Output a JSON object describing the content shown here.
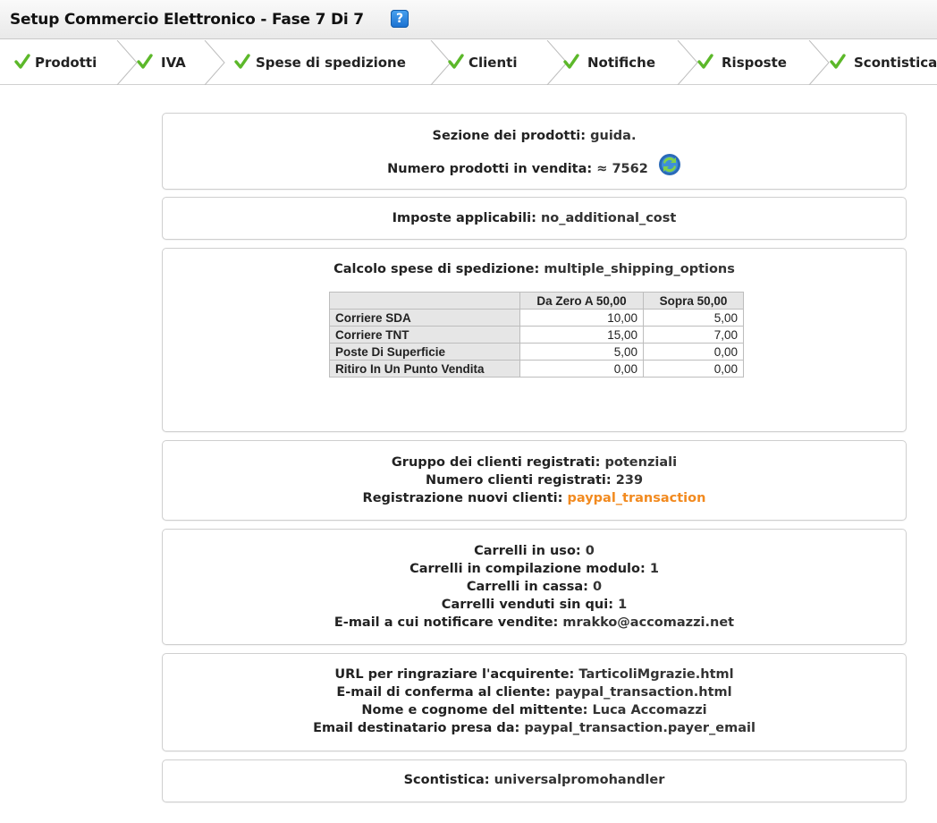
{
  "header": {
    "title": "Setup Commercio Elettronico - Fase 7 Di 7",
    "help_icon": "?"
  },
  "steps": [
    {
      "label": "Prodotti"
    },
    {
      "label": "IVA"
    },
    {
      "label": "Spese di spedizione"
    },
    {
      "label": "Clienti"
    },
    {
      "label": "Notifiche"
    },
    {
      "label": "Risposte"
    },
    {
      "label": "Scontistica"
    }
  ],
  "colors": {
    "check": "#5cb82a",
    "orange": "#f28a1f"
  },
  "prodotti": {
    "sezione_label": "Sezione dei prodotti:",
    "sezione_value": "guida.",
    "numero_label": "Numero prodotti in vendita:",
    "numero_value": "≈ 7562"
  },
  "iva": {
    "label": "Imposte applicabili:",
    "value": "no_additional_cost"
  },
  "spedizione": {
    "label": "Calcolo spese di spedizione:",
    "value": "multiple_shipping_options",
    "table": {
      "headers": [
        "",
        "Da Zero A 50,00",
        "Sopra 50,00"
      ],
      "rows": [
        {
          "name": "Corriere SDA",
          "a": "10,00",
          "b": "5,00"
        },
        {
          "name": "Corriere TNT",
          "a": "15,00",
          "b": "7,00"
        },
        {
          "name": "Poste Di Superficie",
          "a": "5,00",
          "b": "0,00"
        },
        {
          "name": "Ritiro In Un Punto Vendita",
          "a": "0,00",
          "b": "0,00"
        }
      ]
    }
  },
  "clienti": {
    "gruppo_label": "Gruppo dei clienti registrati:",
    "gruppo_value": "potenziali",
    "numero_label": "Numero clienti registrati:",
    "numero_value": "239",
    "registrazione_label": "Registrazione nuovi clienti:",
    "registrazione_value": "paypal_transaction"
  },
  "notifiche": {
    "uso_label": "Carrelli in uso:",
    "uso_value": "0",
    "compilazione_label": "Carrelli in compilazione modulo:",
    "compilazione_value": "1",
    "cassa_label": "Carrelli in cassa:",
    "cassa_value": "0",
    "venduti_label": "Carrelli venduti sin qui:",
    "venduti_value": "1",
    "email_label": "E-mail a cui notificare vendite:",
    "email_value": "mrakko@accomazzi.net"
  },
  "risposte": {
    "url_label": "URL per ringraziare l'acquirente:",
    "url_value": "TarticoliMgrazie.html",
    "conferma_label": "E-mail di conferma al cliente:",
    "conferma_value": "paypal_transaction.html",
    "mittente_label": "Nome e cognome del mittente:",
    "mittente_value": "Luca Accomazzi",
    "destinatario_label": "Email destinatario presa da:",
    "destinatario_value": "paypal_transaction.payer_email"
  },
  "scontistica": {
    "label": "Scontistica:",
    "value": "universalpromohandler"
  }
}
